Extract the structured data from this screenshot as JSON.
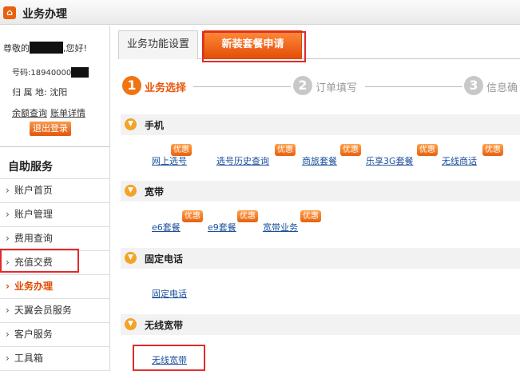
{
  "header": {
    "logo_icon": "home-icon",
    "title": "业务办理"
  },
  "user": {
    "greet_prefix": "尊敬的",
    "greet_suffix": ",您好!",
    "phone_label": "号码:",
    "phone_visible": "18940000",
    "region_label": "归 属 地:",
    "region_value": "沈阳",
    "link_balance": "余额查询",
    "link_bill": "账单详情",
    "logout": "退出登录"
  },
  "nav": {
    "heading": "自助服务",
    "items": [
      {
        "label": "账户首页"
      },
      {
        "label": "账户管理"
      },
      {
        "label": "费用查询"
      },
      {
        "label": "充值交费"
      },
      {
        "label": "业务办理"
      },
      {
        "label": "天翼会员服务"
      },
      {
        "label": "客户服务"
      },
      {
        "label": "工具箱"
      }
    ],
    "active_index": 4
  },
  "tabs": [
    {
      "label": "业务功能设置"
    },
    {
      "label": "新装套餐申请"
    }
  ],
  "steps": [
    {
      "num": "1",
      "label": "业务选择"
    },
    {
      "num": "2",
      "label": "订单填写"
    },
    {
      "num": "3",
      "label": "信息确"
    }
  ],
  "badge_text": "优惠",
  "sections": [
    {
      "label": "手机",
      "items": [
        "网上选号",
        "选号历史查询",
        "商旅套餐",
        "乐享3G套餐",
        "无线商话"
      ]
    },
    {
      "label": "宽带",
      "items": [
        "e6套餐",
        "e9套餐",
        "宽带业务"
      ]
    },
    {
      "label": "固定电话",
      "items": [
        "固定电话"
      ]
    },
    {
      "label": "无线宽带",
      "items": [
        "无线宽带"
      ]
    }
  ],
  "colors": {
    "accent": "#e8560c",
    "link": "#1a4f9c",
    "highlight_box": "#e12a2a"
  }
}
